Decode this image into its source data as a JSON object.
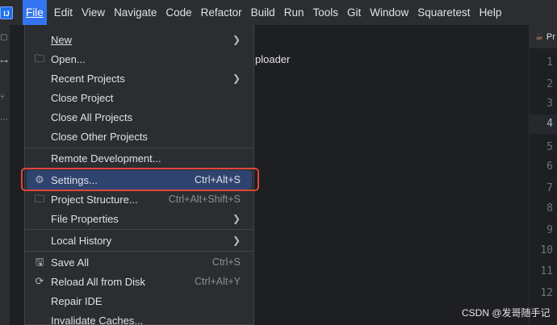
{
  "menubar": {
    "logo_text": "IJ",
    "items": [
      "File",
      "Edit",
      "View",
      "Navigate",
      "Code",
      "Refactor",
      "Build",
      "Run",
      "Tools",
      "Git",
      "Window",
      "Squaretest",
      "Help"
    ]
  },
  "background": {
    "editor_text": "ploader",
    "tab_label": "Pr",
    "line_numbers": [
      "1",
      "2",
      "3",
      "4",
      "5",
      "6",
      "7",
      "8",
      "9",
      "10",
      "11",
      "12"
    ],
    "current_line": "4"
  },
  "file_menu": {
    "new": "New",
    "open": "Open...",
    "recent_projects": "Recent Projects",
    "close_project": "Close Project",
    "close_all_projects": "Close All Projects",
    "close_other_projects": "Close Other Projects",
    "remote_development": "Remote Development...",
    "settings": "Settings...",
    "settings_shortcut": "Ctrl+Alt+S",
    "project_structure": "Project Structure...",
    "project_structure_shortcut": "Ctrl+Alt+Shift+S",
    "file_properties": "File Properties",
    "local_history": "Local History",
    "save_all": "Save All",
    "save_all_shortcut": "Ctrl+S",
    "reload_all": "Reload All from Disk",
    "reload_all_shortcut": "Ctrl+Alt+Y",
    "repair_ide": "Repair IDE",
    "invalidate_caches": "Invalidate Caches..."
  },
  "watermark": "CSDN @发哥随手记",
  "colors": {
    "accent": "#3574f0",
    "selection": "#2e436e",
    "highlight_border": "#e0463c"
  }
}
